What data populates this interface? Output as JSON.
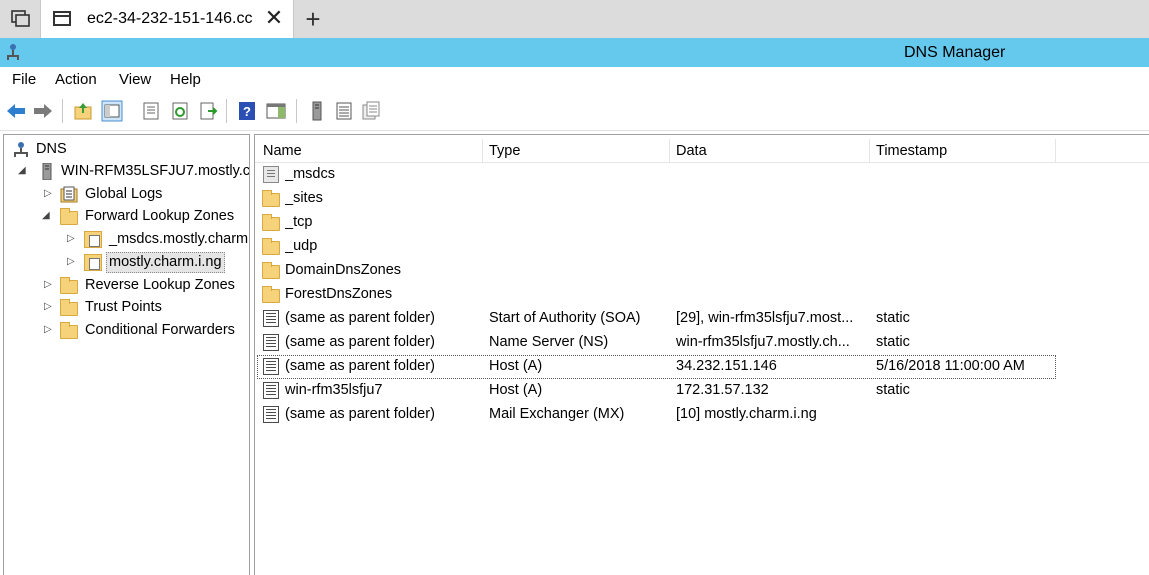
{
  "browser": {
    "tab_title": "ec2-34-232-151-146.cc",
    "close_glyph": "✕",
    "new_tab_glyph": "+"
  },
  "window": {
    "title": "DNS Manager"
  },
  "menu": [
    "File",
    "Action",
    "View",
    "Help"
  ],
  "toolbar": {
    "icons": [
      "back-icon",
      "forward-icon",
      "up-folder-icon",
      "show-hide-console-tree-icon",
      "properties-icon",
      "refresh-icon",
      "export-list-icon",
      "help-icon",
      "show-action-pane-icon",
      "server-icon",
      "list-icon",
      "records-icon"
    ]
  },
  "tree": {
    "root": "DNS",
    "server": "WIN-RFM35LSFJU7.mostly.c",
    "items": [
      {
        "label": "Global Logs"
      },
      {
        "label": "Forward Lookup Zones"
      },
      {
        "label": "_msdcs.mostly.charm"
      },
      {
        "label": "mostly.charm.i.ng"
      },
      {
        "label": "Reverse Lookup Zones"
      },
      {
        "label": "Trust Points"
      },
      {
        "label": "Conditional Forwarders"
      }
    ]
  },
  "list": {
    "columns": [
      "Name",
      "Type",
      "Data",
      "Timestamp"
    ],
    "rows": [
      {
        "name": "_msdcs",
        "type": "",
        "data": "",
        "timestamp": "",
        "icon": "msdcs-icon"
      },
      {
        "name": "_sites",
        "type": "",
        "data": "",
        "timestamp": "",
        "icon": "folder-icon"
      },
      {
        "name": "_tcp",
        "type": "",
        "data": "",
        "timestamp": "",
        "icon": "folder-icon"
      },
      {
        "name": "_udp",
        "type": "",
        "data": "",
        "timestamp": "",
        "icon": "folder-icon"
      },
      {
        "name": "DomainDnsZones",
        "type": "",
        "data": "",
        "timestamp": "",
        "icon": "folder-icon"
      },
      {
        "name": "ForestDnsZones",
        "type": "",
        "data": "",
        "timestamp": "",
        "icon": "folder-icon"
      },
      {
        "name": "(same as parent folder)",
        "type": "Start of Authority (SOA)",
        "data": "[29], win-rfm35lsfju7.most...",
        "timestamp": "static",
        "icon": "record-icon"
      },
      {
        "name": "(same as parent folder)",
        "type": "Name Server (NS)",
        "data": "win-rfm35lsfju7.mostly.ch...",
        "timestamp": "static",
        "icon": "record-icon"
      },
      {
        "name": "(same as parent folder)",
        "type": "Host (A)",
        "data": "34.232.151.146",
        "timestamp": "5/16/2018 11:00:00 AM",
        "icon": "record-icon"
      },
      {
        "name": "win-rfm35lsfju7",
        "type": "Host (A)",
        "data": "172.31.57.132",
        "timestamp": "static",
        "icon": "record-icon"
      },
      {
        "name": "(same as parent folder)",
        "type": "Mail Exchanger (MX)",
        "data": "[10]  mostly.charm.i.ng",
        "timestamp": "",
        "icon": "record-icon"
      }
    ]
  }
}
